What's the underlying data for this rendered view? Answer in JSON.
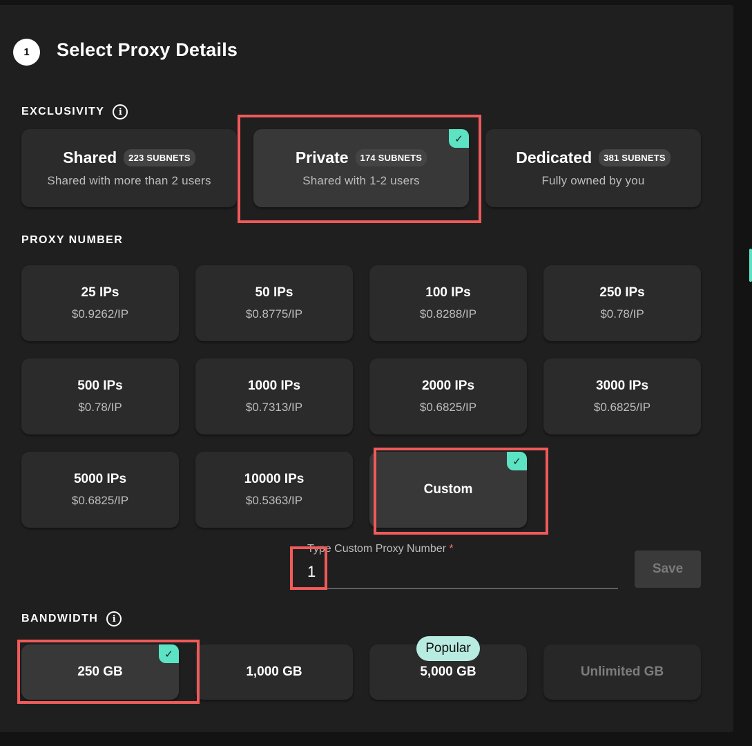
{
  "step": {
    "number": "1",
    "title": "Select Proxy Details"
  },
  "exclusivity": {
    "label": "EXCLUSIVITY",
    "info_icon": "info-icon",
    "options": [
      {
        "name": "Shared",
        "badge": "223 SUBNETS",
        "desc": "Shared with more than 2 users",
        "selected": false
      },
      {
        "name": "Private",
        "badge": "174 SUBNETS",
        "desc": "Shared with 1-2 users",
        "selected": true
      },
      {
        "name": "Dedicated",
        "badge": "381 SUBNETS",
        "desc": "Fully owned by you",
        "selected": false
      }
    ]
  },
  "proxy_number": {
    "label": "PROXY NUMBER",
    "options": [
      {
        "name": "25 IPs",
        "price": "$0.9262/IP"
      },
      {
        "name": "50 IPs",
        "price": "$0.8775/IP"
      },
      {
        "name": "100 IPs",
        "price": "$0.8288/IP"
      },
      {
        "name": "250 IPs",
        "price": "$0.78/IP"
      },
      {
        "name": "500 IPs",
        "price": "$0.78/IP"
      },
      {
        "name": "1000 IPs",
        "price": "$0.7313/IP"
      },
      {
        "name": "2000 IPs",
        "price": "$0.6825/IP"
      },
      {
        "name": "3000 IPs",
        "price": "$0.6825/IP"
      },
      {
        "name": "5000 IPs",
        "price": "$0.6825/IP"
      },
      {
        "name": "10000 IPs",
        "price": "$0.5363/IP"
      }
    ],
    "custom": {
      "label": "Custom",
      "selected": true
    },
    "custom_input": {
      "label": "Type Custom Proxy Number",
      "required_mark": "*",
      "value": "1"
    },
    "save_label": "Save"
  },
  "bandwidth": {
    "label": "BANDWIDTH",
    "info_icon": "info-icon",
    "popular_badge": "Popular",
    "options": [
      {
        "label": "250 GB",
        "selected": true
      },
      {
        "label": "1,000 GB",
        "selected": false
      },
      {
        "label": "5,000 GB",
        "selected": false
      },
      {
        "label": "Unlimited GB",
        "selected": false,
        "disabled": true
      }
    ]
  },
  "colors": {
    "accent": "#5be3c3",
    "highlight": "#f05a5a",
    "popular_bg": "#b8ece0"
  }
}
